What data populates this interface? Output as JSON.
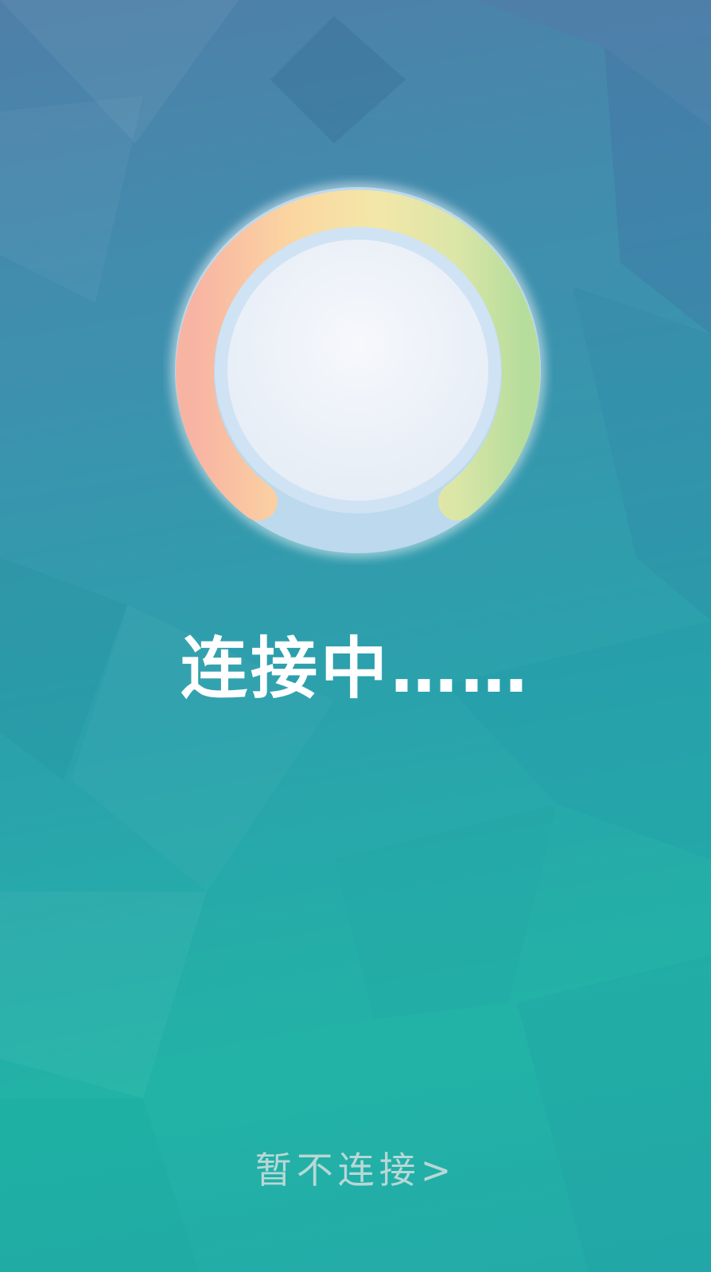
{
  "connection": {
    "status_text": "连接中……",
    "skip_label": "暂不连接>"
  },
  "gauge": {
    "arc_colors": [
      "#f8b4a3",
      "#fbd6a1",
      "#f3e7a8",
      "#dbe6a7",
      "#b7dd9c"
    ],
    "inner_color": "#eef3f9",
    "ring_color": "#bcd9ee"
  },
  "theme": {
    "background_top": "#4f7fa8",
    "background_bottom": "#22b3a6",
    "text_color": "#ffffff",
    "link_color": "#b8d8d6"
  }
}
